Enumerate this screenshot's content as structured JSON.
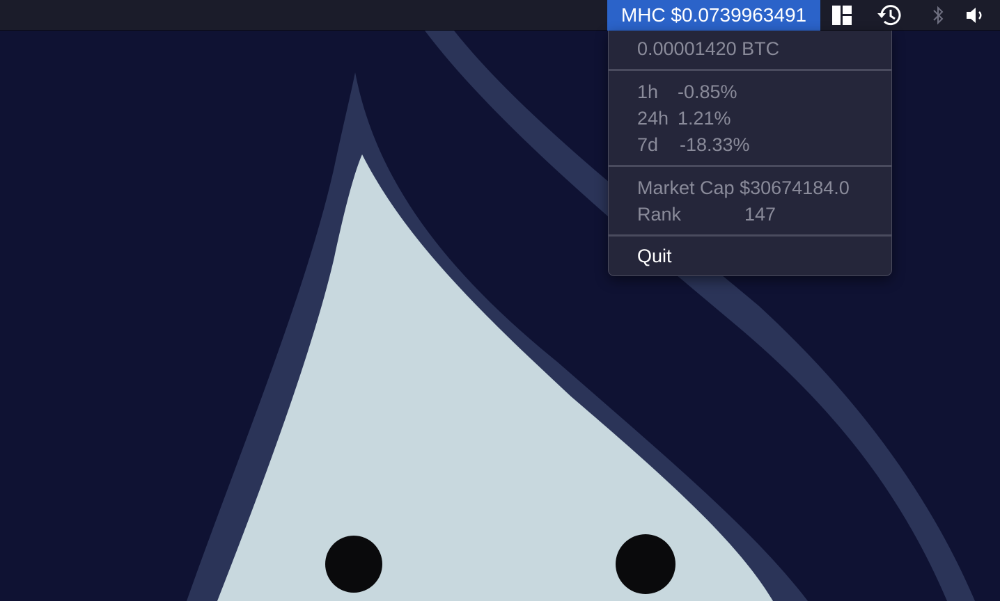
{
  "menubar": {
    "ticker_label": "MHC $0.0739963491",
    "icons": [
      "window-layout-icon",
      "time-machine-icon",
      "bluetooth-icon",
      "volume-icon"
    ]
  },
  "menu": {
    "btc_price": "0.00001420 BTC",
    "changes": [
      {
        "period": "1h",
        "value": "-0.85%"
      },
      {
        "period": "24h",
        "value": "1.21%"
      },
      {
        "period": "7d",
        "value": "-18.33%"
      }
    ],
    "market_cap_label": "Market Cap",
    "market_cap_value": "$30674184.0",
    "rank_label": "Rank",
    "rank_value": "147",
    "quit_label": "Quit"
  },
  "colors": {
    "menubar_bg": "#1b1c2a",
    "ticker_highlight": "#2b63c9",
    "menu_bg": "#25263a",
    "menu_text_disabled": "#8a8b9a",
    "wallpaper_bg": "#0f1233",
    "flame_outline": "#2b3458",
    "flame_fill": "#c8d8de"
  }
}
